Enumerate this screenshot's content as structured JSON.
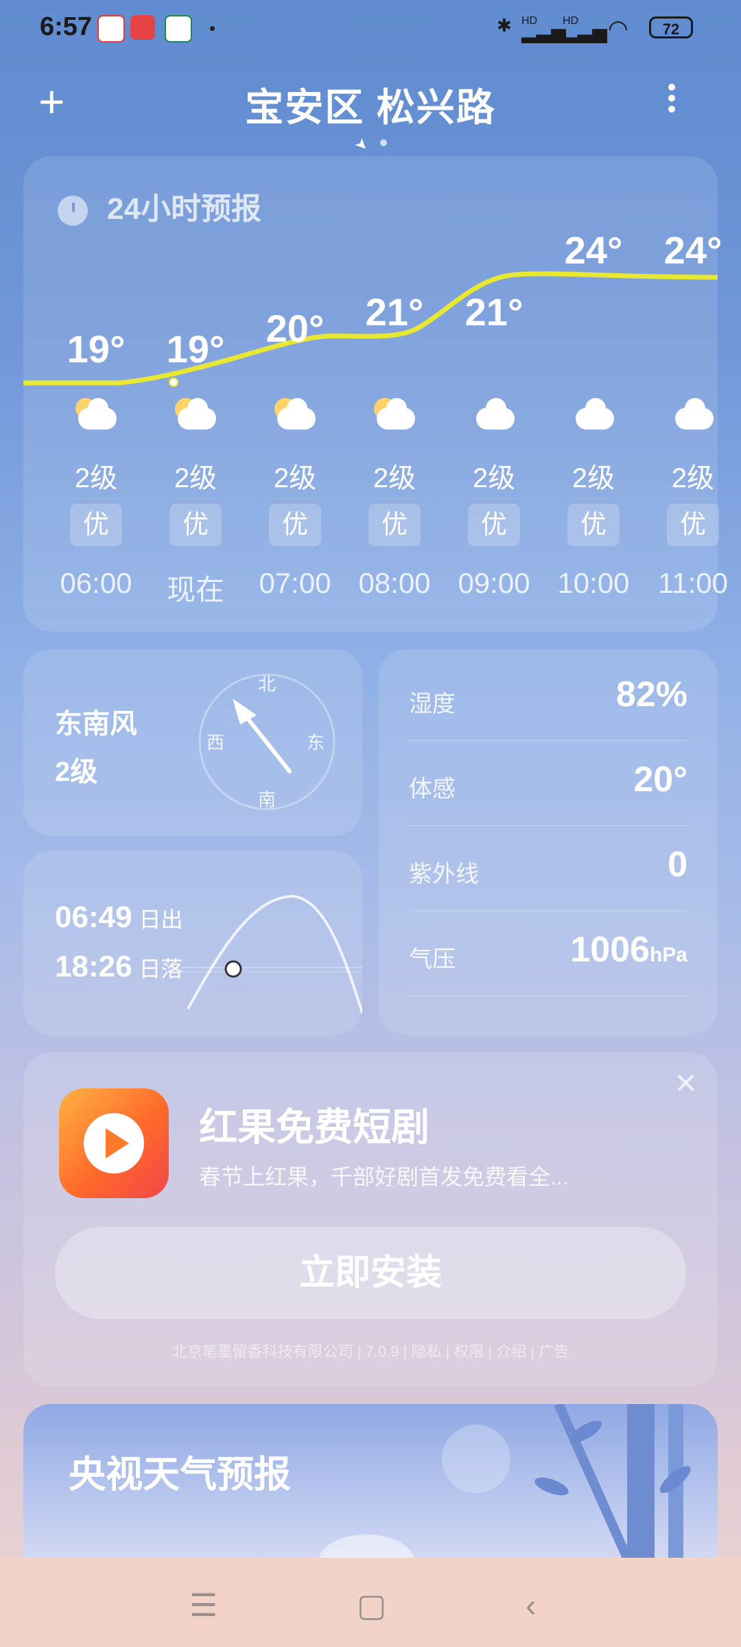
{
  "status_bar": {
    "time": "6:57",
    "network1": "HD",
    "network2": "HD",
    "battery": "72"
  },
  "header": {
    "city": "宝安区 松兴路"
  },
  "hourly": {
    "title": "24小时预报",
    "items": [
      {
        "temp": "19°",
        "icon": "moon-cloud-icon",
        "wind": "2级",
        "aqi": "优",
        "time": "06:00"
      },
      {
        "temp": "19°",
        "icon": "sun-cloud-icon",
        "wind": "2级",
        "aqi": "优",
        "time": "现在"
      },
      {
        "temp": "20°",
        "icon": "sun-cloud-icon",
        "wind": "2级",
        "aqi": "优",
        "time": "07:00"
      },
      {
        "temp": "21°",
        "icon": "sun-cloud-icon",
        "wind": "2级",
        "aqi": "优",
        "time": "08:00"
      },
      {
        "temp": "21°",
        "icon": "cloud-icon",
        "wind": "2级",
        "aqi": "优",
        "time": "09:00"
      },
      {
        "temp": "24°",
        "icon": "cloud-icon",
        "wind": "2级",
        "aqi": "优",
        "time": "10:00"
      },
      {
        "temp": "24°",
        "icon": "cloud-icon",
        "wind": "2级",
        "aqi": "优",
        "time": "11:00"
      }
    ]
  },
  "wind": {
    "direction": "东南风",
    "level": "2级",
    "compass": {
      "n": "北",
      "s": "南",
      "e": "东",
      "w": "西"
    }
  },
  "sun": {
    "sunrise_time": "06:49",
    "sunrise_label": "日出",
    "sunset_time": "18:26",
    "sunset_label": "日落"
  },
  "details": {
    "humidity_label": "湿度",
    "humidity": "82%",
    "feels_label": "体感",
    "feels": "20°",
    "uv_label": "紫外线",
    "uv": "0",
    "pressure_label": "气压",
    "pressure": "1006",
    "pressure_unit": "hPa"
  },
  "ad": {
    "title": "红果免费短剧",
    "subtitle": "春节上红果，千部好剧首发免费看全...",
    "install": "立即安装",
    "footer": "北京笔墨留香科技有限公司 | 7.0.9 | 隐私 | 权限 | 介绍 | 广告"
  },
  "cctv": {
    "title": "央视天气预报"
  },
  "colors": {
    "temp_line": "#e8e832",
    "accent": "#6f95d8"
  }
}
